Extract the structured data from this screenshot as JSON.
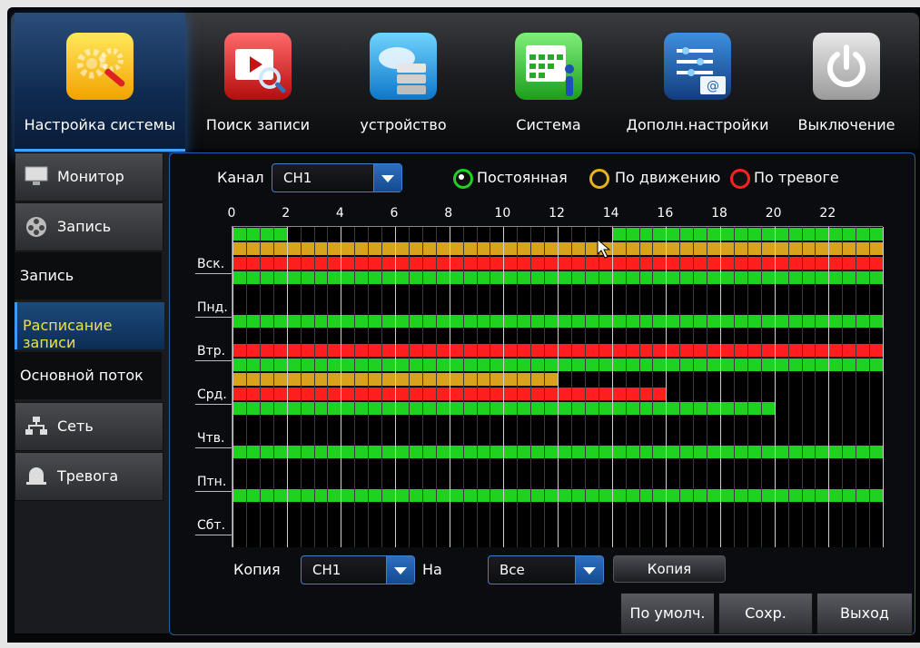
{
  "top_menu": [
    {
      "label": "Настройка системы",
      "icon": "gears-icon",
      "active": true
    },
    {
      "label": "Поиск записи",
      "icon": "video-search-icon",
      "active": false
    },
    {
      "label": "устройство",
      "icon": "cloud-storage-icon",
      "active": false
    },
    {
      "label": "Система",
      "icon": "calendar-info-icon",
      "active": false
    },
    {
      "label": "Дополн.настройки",
      "icon": "settings-mail-icon",
      "active": false
    },
    {
      "label": "Выключение",
      "icon": "power-icon",
      "active": false
    }
  ],
  "left_menu": [
    {
      "label": "Монитор",
      "icon": "monitor-icon",
      "kind": "btn"
    },
    {
      "label": "Запись",
      "icon": "film-reel-icon",
      "kind": "btn"
    },
    {
      "label": "Запись",
      "kind": "plain"
    },
    {
      "label": "Расписание записи",
      "kind": "selected"
    },
    {
      "label": "Основной поток",
      "kind": "plain"
    },
    {
      "label": "Сеть",
      "icon": "network-icon",
      "kind": "btn"
    },
    {
      "label": "Тревога",
      "icon": "alarm-icon",
      "kind": "btn"
    }
  ],
  "channel": {
    "label": "Канал",
    "value": "CH1"
  },
  "legend": [
    {
      "label": "Постоянная",
      "color": "#1fd21f",
      "selected": true
    },
    {
      "label": "По движению",
      "color": "#e7b21a",
      "selected": false
    },
    {
      "label": "По тревоге",
      "color": "#ff2020",
      "selected": false
    }
  ],
  "hour_labels": [
    "0",
    "2",
    "4",
    "6",
    "8",
    "10",
    "12",
    "14",
    "16",
    "18",
    "20",
    "22"
  ],
  "days": [
    "Вск.",
    "Пнд.",
    "Втр.",
    "Срд.",
    "Чтв.",
    "Птн.",
    "Сбт."
  ],
  "colors": {
    "normal": "#1fd21f",
    "motion": "#d9a21b",
    "alarm": "#ff1f1f",
    "empty": "#0a0a0a"
  },
  "schedule": [
    {
      "day": "Вск.",
      "normal": [
        [
          0,
          2
        ],
        [
          14,
          24
        ]
      ],
      "motion": [
        [
          0,
          24
        ]
      ],
      "alarm": [
        [
          0,
          24
        ]
      ]
    },
    {
      "day": "Пнд.",
      "normal": [
        [
          0,
          24
        ]
      ],
      "motion": [],
      "alarm": []
    },
    {
      "day": "Втр.",
      "normal": [
        [
          0,
          24
        ]
      ],
      "motion": [],
      "alarm": [
        [
          0,
          24
        ]
      ]
    },
    {
      "day": "Срд.",
      "normal": [
        [
          0,
          24
        ]
      ],
      "motion": [
        [
          0,
          12
        ]
      ],
      "alarm": [
        [
          0,
          16
        ]
      ]
    },
    {
      "day": "Чтв.",
      "normal": [
        [
          0,
          20
        ]
      ],
      "motion": [],
      "alarm": []
    },
    {
      "day": "Птн.",
      "normal": [
        [
          0,
          24
        ]
      ],
      "motion": [],
      "alarm": []
    },
    {
      "day": "Сбт.",
      "normal": [
        [
          0,
          24
        ]
      ],
      "motion": [],
      "alarm": []
    }
  ],
  "copy_row": {
    "label": "Копия",
    "from_value": "CH1",
    "to_label": "На",
    "to_value": "Все",
    "button": "Копия"
  },
  "bottom_buttons": {
    "default": "По умолч.",
    "save": "Сохр.",
    "exit": "Выход"
  }
}
